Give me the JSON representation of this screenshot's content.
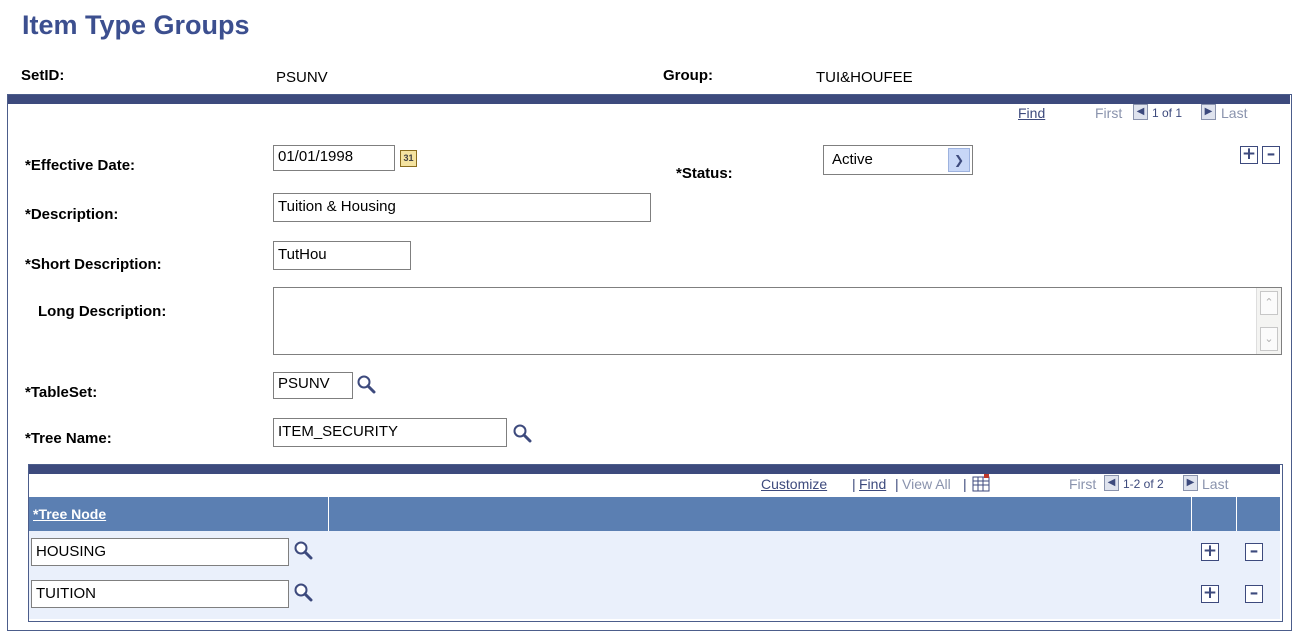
{
  "page": {
    "title": "Item Type Groups",
    "setid_label": "SetID:",
    "setid_value": "PSUNV",
    "group_label": "Group:",
    "group_value": "TUI&HOUFEE"
  },
  "navbar": {
    "find": "Find",
    "first": "First",
    "range": "1 of 1",
    "last": "Last"
  },
  "form": {
    "effective_date_label": "*Effective Date:",
    "effective_date_value": "01/01/1998",
    "calendar_icon_text": "31",
    "status_label": "*Status:",
    "status_value": "Active",
    "description_label": "*Description:",
    "description_value": "Tuition & Housing",
    "short_description_label": "*Short Description:",
    "short_description_value": "TutHou",
    "long_description_label": "Long Description:",
    "long_description_value": "",
    "tableset_label": "*TableSet:",
    "tableset_value": "PSUNV",
    "tree_name_label": "*Tree Name:",
    "tree_name_value": "ITEM_SECURITY"
  },
  "grid": {
    "customize": "Customize",
    "sep1": "|",
    "find": "Find",
    "sep2": "|",
    "view_all": "View All",
    "sep3": "|",
    "first": "First",
    "range": "1-2 of 2",
    "last": "Last",
    "column_header": "*Tree Node",
    "rows": [
      {
        "tree_node": "HOUSING"
      },
      {
        "tree_node": "TUITION"
      }
    ]
  },
  "icons": {
    "lookup": "magnifier-icon",
    "calendar": "calendar-icon",
    "add_row": "plus-icon",
    "delete_row": "minus-icon",
    "download": "grid-download-icon"
  },
  "colors": {
    "title": "#3c4f8f",
    "navbar": "#3d4a7d",
    "grid_header": "#5b7fb2",
    "grid_body": "#eaf0fb"
  }
}
